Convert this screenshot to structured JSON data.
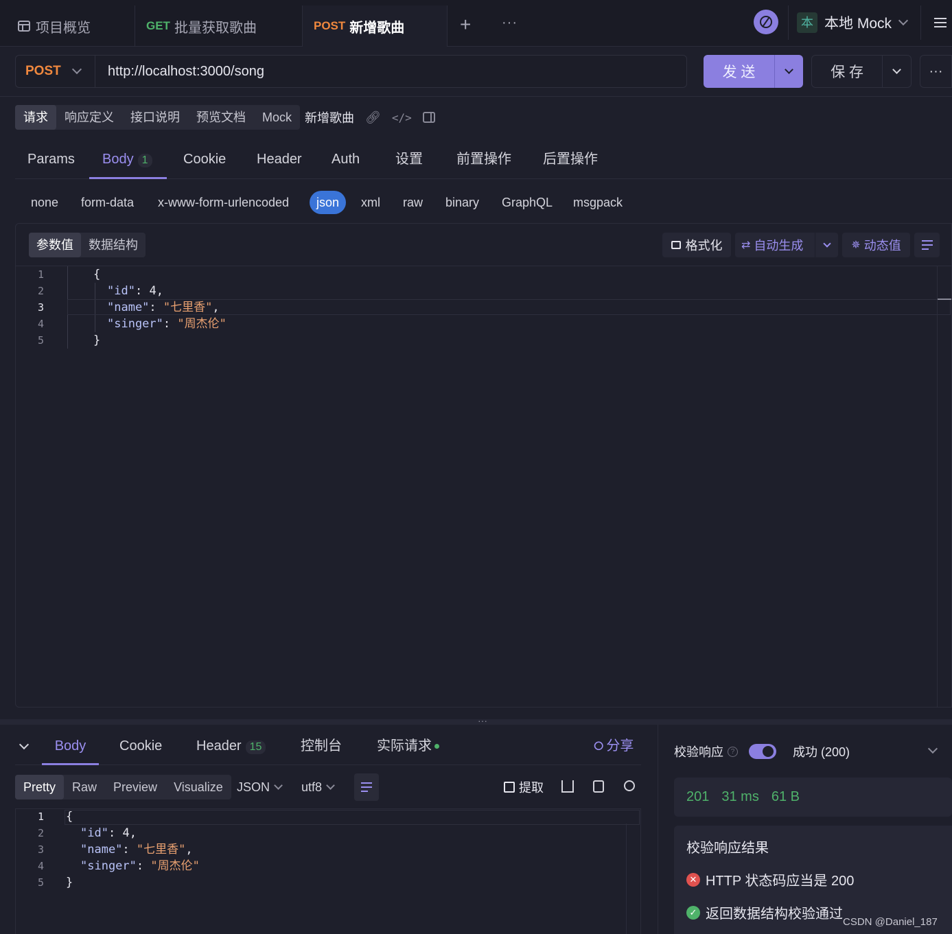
{
  "top_tabs": {
    "overview": "项目概览",
    "tab2_method": "GET",
    "tab2_name": "批量获取歌曲",
    "tab3_method": "POST",
    "tab3_name": "新增歌曲",
    "add": "+",
    "more": "···"
  },
  "env": {
    "avatar_char": "本",
    "label": "本地 Mock"
  },
  "request": {
    "method": "POST",
    "url": "http://localhost:3000/song",
    "send_label": "发 送",
    "save_label": "保 存"
  },
  "subtabs": [
    "请求",
    "响应定义",
    "接口说明",
    "预览文档",
    "Mock"
  ],
  "api_name": "新增歌曲",
  "param_tabs": {
    "params": "Params",
    "body": "Body",
    "body_count": "1",
    "cookie": "Cookie",
    "header": "Header",
    "auth": "Auth",
    "settings": "设置",
    "pre": "前置操作",
    "post": "后置操作"
  },
  "body_types": [
    "none",
    "form-data",
    "x-www-form-urlencoded",
    "json",
    "xml",
    "raw",
    "binary",
    "GraphQL",
    "msgpack"
  ],
  "editor_toolbar": {
    "values_tab": "参数值",
    "schema_tab": "数据结构",
    "format": "格式化",
    "autogen": "自动生成",
    "dynamic": "动态值"
  },
  "request_body_lines": [
    {
      "n": "1",
      "text": "{"
    },
    {
      "n": "2",
      "k": "\"id\"",
      "v": "4",
      "tail": ","
    },
    {
      "n": "3",
      "k": "\"name\"",
      "v": "\"七里香\"",
      "tail": ","
    },
    {
      "n": "4",
      "k": "\"singer\"",
      "v": "\"周杰伦\"",
      "tail": ""
    },
    {
      "n": "5",
      "text": "}"
    }
  ],
  "response_tabs": {
    "body": "Body",
    "cookie": "Cookie",
    "header": "Header",
    "header_count": "15",
    "console": "控制台",
    "actual": "实际请求",
    "share": "分享"
  },
  "response_view": {
    "pretty": "Pretty",
    "raw": "Raw",
    "preview": "Preview",
    "visualize": "Visualize",
    "format": "JSON",
    "encoding": "utf8",
    "extract": "提取"
  },
  "response_body_lines": [
    {
      "n": "1",
      "text": "{"
    },
    {
      "n": "2",
      "k": "\"id\"",
      "v": "4",
      "tail": ","
    },
    {
      "n": "3",
      "k": "\"name\"",
      "v": "\"七里香\"",
      "tail": ","
    },
    {
      "n": "4",
      "k": "\"singer\"",
      "v": "\"周杰伦\"",
      "tail": ""
    },
    {
      "n": "5",
      "text": "}"
    }
  ],
  "validation": {
    "label": "校验响应",
    "rule": "成功 (200)",
    "status": "201",
    "time": "31 ms",
    "size": "61 B",
    "results_title": "校验响应结果",
    "result_fail": "HTTP 状态码应当是 200",
    "result_pass": "返回数据结构校验通过"
  },
  "watermark": "CSDN @Daniel_187",
  "colors": {
    "accent": "#8b7fe0",
    "post": "#f0883e",
    "get": "#4fb26a",
    "json_pill": "#3a74d8",
    "fail": "#e0524f",
    "pass": "#4fb26a"
  }
}
